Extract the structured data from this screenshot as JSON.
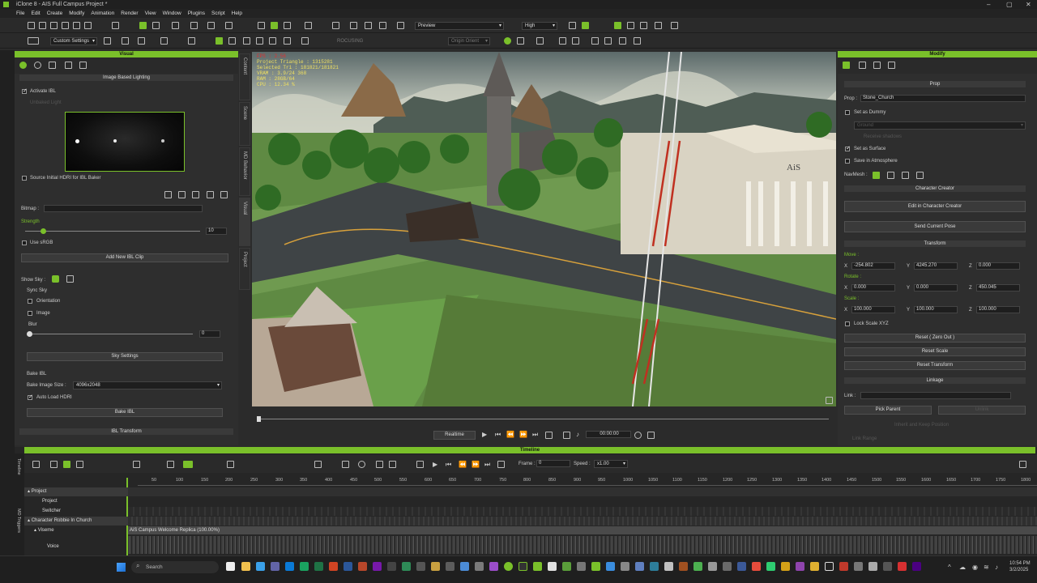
{
  "app": {
    "title": "iClone 8 - AIS Full Campus Project *",
    "win_controls": [
      "–",
      "▢",
      "✕"
    ]
  },
  "menu": [
    "File",
    "Edit",
    "Create",
    "Modify",
    "Animation",
    "Render",
    "View",
    "Window",
    "Plugins",
    "Script",
    "Help"
  ],
  "toolbar": {
    "quality_preview": "Preview",
    "quality_high": "High",
    "custom_settings": "Custom Settings",
    "focus": "ROCUSING",
    "origin": "Origin Orient"
  },
  "visual_panel": {
    "title": "Visual",
    "ibl_section": "Image Based Lighting",
    "activate_ibl": "Activate IBL",
    "unbaked": "Unbaked Light",
    "source_hdri": "Source Initial HDRI for IBL Baker",
    "bitmap": "Bitmap :",
    "strength": "Strength",
    "strength_value": "10",
    "strength_pct": 0.1,
    "use_srgb": "Use sRGB",
    "add_clip": "Add New IBL Clip",
    "show_sky": "Show Sky :",
    "sync_sky": "Sync Sky",
    "orientation": "Orientation",
    "image": "Image",
    "blur": "Blur",
    "blur_value": "0",
    "sky_settings": "Sky Settings",
    "bake_ibl_label": "Bake IBL",
    "bake_size_label": "Bake Image Size :",
    "bake_size": "4096x2048",
    "auto_load": "Auto Load HDRI",
    "bake_button": "Bake IBL",
    "ibl_transform": "IBL Transform"
  },
  "side_tabs": [
    "Content",
    "Scene",
    "MD Behavior",
    "Visual",
    "Project"
  ],
  "viewport": {
    "stats": [
      "FPS : 2.56",
      "Project Triangle : 1315281",
      "Selected Tri : 181821/181821",
      "VRAM : 3.9/24 368",
      "RAM : 28GB/64",
      "CPU : 12.34 %"
    ],
    "building_sign": "AiS"
  },
  "playback": {
    "mode": "Realtime",
    "time": "00:00:00"
  },
  "modify_panel": {
    "title": "Modify",
    "prop_section": "Prop",
    "prop_label": "Prop :",
    "prop_name": "Stone_Church",
    "set_dummy": "Set as Dummy",
    "dummy_drop": "Ground",
    "receive_shadows": "Receive shadows",
    "set_surface": "Set as Surface",
    "save_atmosphere": "Save in Atmosphere",
    "navmesh": "NavMesh :",
    "cc_section": "Character Creator",
    "edit_cc": "Edit in Character Creator",
    "send_pose": "Send Current Pose",
    "transform_section": "Transform",
    "move": "Move :",
    "move_x": "-254.802",
    "move_y": "4245.270",
    "move_z": "0.000",
    "rotate": "Rotate :",
    "rot_x": "0.000",
    "rot_y": "0.000",
    "rot_z": "450.045",
    "scale": "Scale :",
    "scale_x": "100.000",
    "scale_y": "100.000",
    "scale_z": "100.000",
    "lock_scale": "Lock Scale XYZ",
    "reset_zero": "Reset ( Zero Out )",
    "reset_scale": "Reset Scale",
    "reset_transform": "Reset Transform",
    "linkage_section": "Linkage",
    "link_label": "Link :",
    "pick_parent": "Pick Parent",
    "unlink": "Unlink",
    "inherit": "Inherit and Keep Position",
    "link_range": "Link Range"
  },
  "timeline": {
    "title": "Timeline",
    "frame_label": "Frame :",
    "frame": "0",
    "speed_label": "Speed :",
    "speed": "x1.00",
    "ruler": [
      "50",
      "100",
      "150",
      "200",
      "250",
      "300",
      "350",
      "400",
      "450",
      "500",
      "550",
      "600",
      "650",
      "700",
      "750",
      "800",
      "850",
      "900",
      "950",
      "1000",
      "1050",
      "1100",
      "1150",
      "1200",
      "1250",
      "1300",
      "1350",
      "1400",
      "1450",
      "1500",
      "1550",
      "1600",
      "1650",
      "1700",
      "1750",
      "1800"
    ],
    "tracks": [
      "Project",
      "Project",
      "Switcher",
      "Character Robbie In Church",
      "Viseme",
      "Voice"
    ],
    "clip": "AiS Campus Welcome Replica (100.00%)",
    "side_tabs": [
      "Timeline",
      "MD Triggers"
    ]
  },
  "taskbar": {
    "search": "Search",
    "time": "10:54 PM",
    "date": "3/2/2025"
  }
}
